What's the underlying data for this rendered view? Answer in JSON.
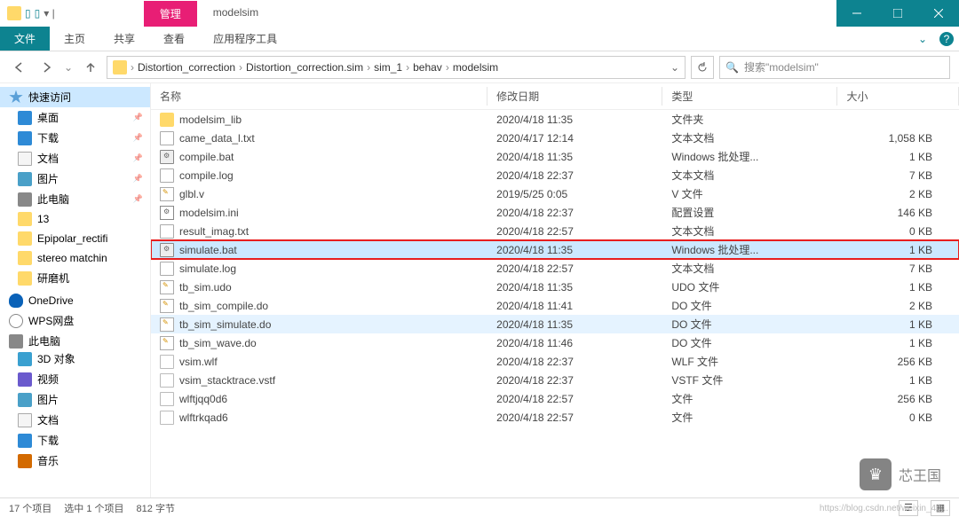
{
  "titlebar": {
    "quick_items": [
      "▣",
      "▣"
    ],
    "context_tab": "管理",
    "folder_name": "modelsim"
  },
  "ribbon": {
    "file": "文件",
    "tabs": [
      "主页",
      "共享",
      "查看",
      "应用程序工具"
    ]
  },
  "breadcrumb": {
    "items": [
      "Distortion_correction",
      "Distortion_correction.sim",
      "sim_1",
      "behav",
      "modelsim"
    ]
  },
  "search": {
    "placeholder": "搜索\"modelsim\""
  },
  "sidebar": {
    "quick_access": "快速访问",
    "items": [
      {
        "label": "桌面",
        "ico": "ico-desktop",
        "pinned": true
      },
      {
        "label": "下载",
        "ico": "ico-download",
        "pinned": true
      },
      {
        "label": "文档",
        "ico": "ico-docs",
        "pinned": true
      },
      {
        "label": "图片",
        "ico": "ico-pics",
        "pinned": true
      },
      {
        "label": "此电脑",
        "ico": "ico-pc",
        "pinned": true
      },
      {
        "label": "13",
        "ico": "ico-folder",
        "pinned": false
      },
      {
        "label": "Epipolar_rectifi",
        "ico": "ico-folder",
        "pinned": false
      },
      {
        "label": "stereo matchin",
        "ico": "ico-folder",
        "pinned": false
      },
      {
        "label": "研磨机",
        "ico": "ico-folder",
        "pinned": false
      }
    ],
    "onedrive": "OneDrive",
    "wps": "WPS网盘",
    "thispc": "此电脑",
    "pc_items": [
      {
        "label": "3D 对象",
        "ico": "ico-3d"
      },
      {
        "label": "视频",
        "ico": "ico-video"
      },
      {
        "label": "图片",
        "ico": "ico-pics"
      },
      {
        "label": "文档",
        "ico": "ico-docs"
      },
      {
        "label": "下载",
        "ico": "ico-download"
      },
      {
        "label": "音乐",
        "ico": "ico-music"
      }
    ]
  },
  "columns": {
    "name": "名称",
    "modified": "修改日期",
    "type": "类型",
    "size": "大小"
  },
  "files": [
    {
      "name": "modelsim_lib",
      "modified": "2020/4/18 11:35",
      "type": "文件夹",
      "size": "",
      "ico": "fi-folder"
    },
    {
      "name": "came_data_l.txt",
      "modified": "2020/4/17 12:14",
      "type": "文本文档",
      "size": "1,058 KB",
      "ico": "fi-txt"
    },
    {
      "name": "compile.bat",
      "modified": "2020/4/18 11:35",
      "type": "Windows 批处理...",
      "size": "1 KB",
      "ico": "fi-bat"
    },
    {
      "name": "compile.log",
      "modified": "2020/4/18 22:37",
      "type": "文本文档",
      "size": "7 KB",
      "ico": "fi-txt"
    },
    {
      "name": "glbl.v",
      "modified": "2019/5/25 0:05",
      "type": "V 文件",
      "size": "2 KB",
      "ico": "fi-v"
    },
    {
      "name": "modelsim.ini",
      "modified": "2020/4/18 22:37",
      "type": "配置设置",
      "size": "146 KB",
      "ico": "fi-ini"
    },
    {
      "name": "result_imag.txt",
      "modified": "2020/4/18 22:57",
      "type": "文本文档",
      "size": "0 KB",
      "ico": "fi-txt"
    },
    {
      "name": "simulate.bat",
      "modified": "2020/4/18 11:35",
      "type": "Windows 批处理...",
      "size": "1 KB",
      "ico": "fi-bat",
      "selected": true,
      "redbox": true
    },
    {
      "name": "simulate.log",
      "modified": "2020/4/18 22:57",
      "type": "文本文档",
      "size": "7 KB",
      "ico": "fi-txt"
    },
    {
      "name": "tb_sim.udo",
      "modified": "2020/4/18 11:35",
      "type": "UDO 文件",
      "size": "1 KB",
      "ico": "fi-v"
    },
    {
      "name": "tb_sim_compile.do",
      "modified": "2020/4/18 11:41",
      "type": "DO 文件",
      "size": "2 KB",
      "ico": "fi-do"
    },
    {
      "name": "tb_sim_simulate.do",
      "modified": "2020/4/18 11:35",
      "type": "DO 文件",
      "size": "1 KB",
      "ico": "fi-do",
      "highlight": true
    },
    {
      "name": "tb_sim_wave.do",
      "modified": "2020/4/18 11:46",
      "type": "DO 文件",
      "size": "1 KB",
      "ico": "fi-do"
    },
    {
      "name": "vsim.wlf",
      "modified": "2020/4/18 22:37",
      "type": "WLF 文件",
      "size": "256 KB",
      "ico": "fi-file"
    },
    {
      "name": "vsim_stacktrace.vstf",
      "modified": "2020/4/18 22:37",
      "type": "VSTF 文件",
      "size": "1 KB",
      "ico": "fi-file"
    },
    {
      "name": "wlftjqq0d6",
      "modified": "2020/4/18 22:57",
      "type": "文件",
      "size": "256 KB",
      "ico": "fi-file"
    },
    {
      "name": "wlftrkqad6",
      "modified": "2020/4/18 22:57",
      "type": "文件",
      "size": "0 KB",
      "ico": "fi-file"
    }
  ],
  "status": {
    "count": "17 个项目",
    "selected": "选中 1 个项目",
    "bytes": "812 字节"
  },
  "watermark": {
    "text": "芯王国",
    "url": "https://blog.csdn.net/weixin_40..."
  }
}
